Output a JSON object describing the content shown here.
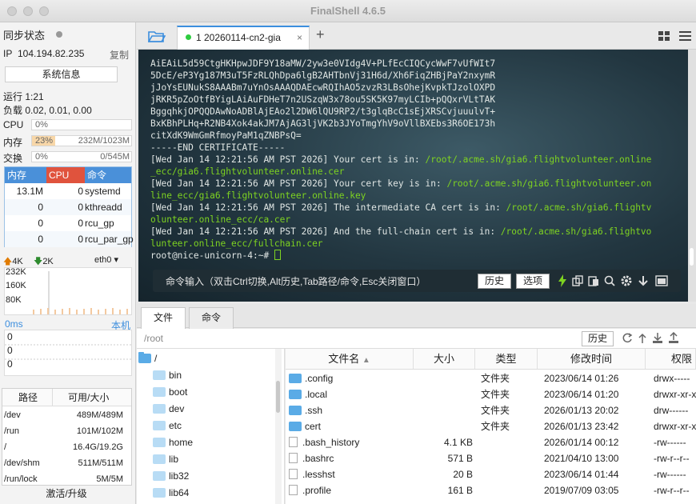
{
  "app": {
    "title": "FinalShell 4.6.5"
  },
  "sidebar": {
    "sync_label": "同步状态",
    "ip_label": "IP",
    "ip_value": "104.194.82.235",
    "copy_label": "复制",
    "sysinfo_label": "系统信息",
    "uptime": "运行 1:21",
    "load": "负载 0.02, 0.01, 0.00",
    "cpu_label": "CPU",
    "cpu_percent": "0%",
    "cpu_fill": 0,
    "mem_label": "内存",
    "mem_percent": "23%",
    "mem_detail": "232M/1023M",
    "mem_fill": 0.23,
    "swap_label": "交换",
    "swap_percent": "0%",
    "swap_detail": "0/545M",
    "swap_fill": 0,
    "proc_headers": {
      "mem": "内存",
      "cpu": "CPU",
      "cmd": "命令"
    },
    "processes": [
      {
        "mem": "13.1M",
        "cpu": "0",
        "cmd": "systemd"
      },
      {
        "mem": "0",
        "cpu": "0",
        "cmd": "kthreadd"
      },
      {
        "mem": "0",
        "cpu": "0",
        "cmd": "rcu_gp"
      },
      {
        "mem": "0",
        "cpu": "0",
        "cmd": "rcu_par_gp"
      }
    ],
    "net_up": "4K",
    "net_down": "2K",
    "net_iface": "eth0",
    "net_ticks": [
      "232K",
      "160K",
      "80K"
    ],
    "latency": "0ms",
    "latency_host": "本机",
    "latency_values": [
      "0",
      "0",
      "0"
    ],
    "disk_headers": {
      "path": "路径",
      "size": "可用/大小"
    },
    "disks": [
      {
        "path": "/dev",
        "size": "489M/489M"
      },
      {
        "path": "/run",
        "size": "101M/102M"
      },
      {
        "path": "/",
        "size": "16.4G/19.2G"
      },
      {
        "path": "/dev/shm",
        "size": "511M/511M"
      },
      {
        "path": "/run/lock",
        "size": "5M/5M"
      }
    ],
    "activate_label": "激活/升级"
  },
  "tabs": {
    "session_label": "1 20260114-cn2-gia"
  },
  "terminal": {
    "lines": [
      {
        "t": "AiEAiL5d59CtgHKHpwJDF9Y18aMW/2yw3e0VIdg4V+PLfEcCIQCycWwF7vUfWIt7",
        "g": ""
      },
      {
        "t": "5DcE/eP3Yg187M3uT5FzRLQhDpa6lgB2AHTbnVj31H6d/Xh6FiqZHBjPaY2nxymR",
        "g": ""
      },
      {
        "t": "jJoYsEUNukS8AAABm7uYnOsAAAQDAEcwRQIhAO5zvzR3LBsOhejKvpkTJzolOXPD",
        "g": ""
      },
      {
        "t": "jRKR5pZoOtfBYigLAiAuFDHeT7n2USzqW3x78ou5SK5K97myLCIb+pQQxrVLtTAK",
        "g": ""
      },
      {
        "t": "BggqhkjOPQQDAwNoADBlAjEAo2l2DW6lQU9RP2/t3glqBcC1sEjXRSCvjuuulvT+",
        "g": ""
      },
      {
        "t": "BxKBhPLHq+R2NB4Xok4akJM7AjAG3ljVK2b3JYoTmgYhV9oVllBXEbs3R6OE173h",
        "g": ""
      },
      {
        "t": "citXdK9WmGmRfmoyPaM1qZNBPsQ=",
        "g": ""
      },
      {
        "t": "-----END CERTIFICATE-----",
        "g": ""
      },
      {
        "t": "[Wed Jan 14 12:21:56 AM PST 2026] Your cert is in: ",
        "g": "/root/.acme.sh/gia6.flightvolunteer.online"
      },
      {
        "t": "",
        "g": "_ecc/gia6.flightvolunteer.online.cer"
      },
      {
        "t": "[Wed Jan 14 12:21:56 AM PST 2026] Your cert key is in: ",
        "g": "/root/.acme.sh/gia6.flightvolunteer.on"
      },
      {
        "t": "",
        "g": "line_ecc/gia6.flightvolunteer.online.key"
      },
      {
        "t": "[Wed Jan 14 12:21:56 AM PST 2026] The intermediate CA cert is in: ",
        "g": "/root/.acme.sh/gia6.flightv"
      },
      {
        "t": "",
        "g": "olunteer.online_ecc/ca.cer"
      },
      {
        "t": "[Wed Jan 14 12:21:56 AM PST 2026] And the full-chain cert is in: ",
        "g": "/root/.acme.sh/gia6.flightvo"
      },
      {
        "t": "",
        "g": "lunteer.online_ecc/fullchain.cer"
      },
      {
        "t": "root@nice-unicorn-4:~# ",
        "g": ""
      }
    ],
    "cmd_hint": "命令输入（双击Ctrl切换,Alt历史,Tab路径/命令,Esc关闭窗口）",
    "history_btn": "历史",
    "options_btn": "选项"
  },
  "lower_tabs": {
    "files": "文件",
    "commands": "命令"
  },
  "filebrowser": {
    "path": "/root",
    "history_btn": "历史",
    "tree": [
      "/",
      "bin",
      "boot",
      "dev",
      "etc",
      "home",
      "lib",
      "lib32",
      "lib64"
    ],
    "headers": {
      "name": "文件名",
      "size": "大小",
      "type": "类型",
      "modified": "修改时间",
      "perm": "权限"
    },
    "files": [
      {
        "name": ".config",
        "size": "",
        "type": "文件夹",
        "modified": "2023/06/14 01:26",
        "perm": "drwx-----",
        "dir": true
      },
      {
        "name": ".local",
        "size": "",
        "type": "文件夹",
        "modified": "2023/06/14 01:20",
        "perm": "drwxr-xr-x",
        "dir": true
      },
      {
        "name": ".ssh",
        "size": "",
        "type": "文件夹",
        "modified": "2026/01/13 20:02",
        "perm": "drw------",
        "dir": true
      },
      {
        "name": "cert",
        "size": "",
        "type": "文件夹",
        "modified": "2026/01/13 23:42",
        "perm": "drwxr-xr-x",
        "dir": true
      },
      {
        "name": ".bash_history",
        "size": "4.1 KB",
        "type": "",
        "modified": "2026/01/14 00:12",
        "perm": "-rw------",
        "dir": false
      },
      {
        "name": ".bashrc",
        "size": "571 B",
        "type": "",
        "modified": "2021/04/10 13:00",
        "perm": "-rw-r--r--",
        "dir": false
      },
      {
        "name": ".lesshst",
        "size": "20 B",
        "type": "",
        "modified": "2023/06/14 01:44",
        "perm": "-rw------",
        "dir": false
      },
      {
        "name": ".profile",
        "size": "161 B",
        "type": "",
        "modified": "2019/07/09 03:05",
        "perm": "-rw-r--r--",
        "dir": false
      }
    ]
  },
  "colors": {
    "accent": "#3c8ede",
    "mem_fill": "#f8d7a8",
    "terminal_green": "#7ed321",
    "proc_header_mem": "#4a90d9",
    "proc_header_cpu": "#e0533d"
  }
}
